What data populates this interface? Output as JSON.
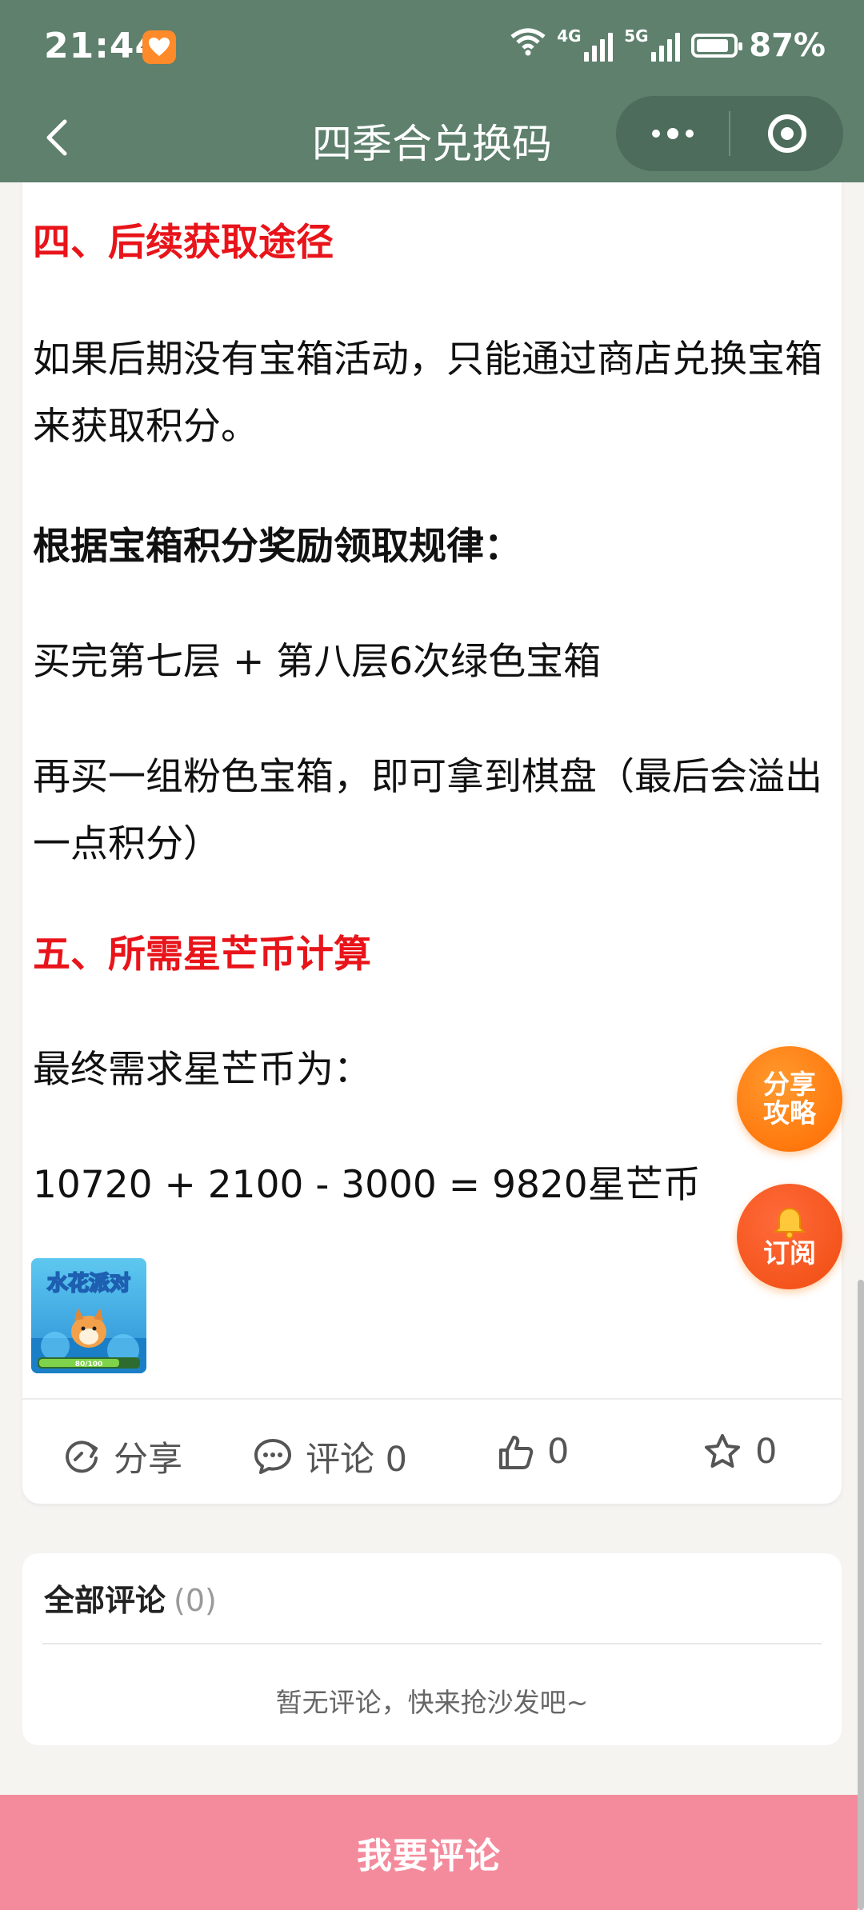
{
  "status_bar": {
    "time": "21:44",
    "network_1": "4G",
    "network_2": "5G",
    "battery": "87%",
    "battery_level": 0.87
  },
  "nav": {
    "title": "四季合兑换码"
  },
  "article": {
    "sections": [
      {
        "kind": "heading-red",
        "text": "四、后续获取途径"
      },
      {
        "kind": "text",
        "text": "如果后期没有宝箱活动，只能通过商店兑换宝箱来获取积分。"
      },
      {
        "kind": "heading-bold",
        "text": "根据宝箱积分奖励领取规律："
      },
      {
        "kind": "text",
        "text": "买完第七层 + 第八层6次绿色宝箱"
      },
      {
        "kind": "text",
        "text": "再买一组粉色宝箱，即可拿到棋盘（最后会溢出一点积分）"
      },
      {
        "kind": "heading-red",
        "text": "五、所需星芒币计算"
      },
      {
        "kind": "text",
        "text": "最终需求星芒币为："
      },
      {
        "kind": "text",
        "text": "10720 + 2100 - 3000 = 9820星芒币"
      }
    ],
    "thumbnail": {
      "title_text": "水花派对",
      "progress_text": "80/100"
    }
  },
  "actions": {
    "share_label": "分享",
    "comment_label": "评论 0",
    "like_count": "0",
    "favorite_count": "0"
  },
  "comments": {
    "title": "全部评论",
    "count": "(0)",
    "empty_text": "暂无评论，快来抢沙发吧~"
  },
  "floating": {
    "share_line1": "分享",
    "share_line2": "攻略",
    "subscribe_label": "订阅"
  },
  "bottom": {
    "comment_button": "我要评论"
  },
  "colors": {
    "nav_bg": "#5e806d",
    "heading_red": "#e8141a",
    "fab_orange": "#ff7a10",
    "bottom_pink": "#f48b9c"
  }
}
